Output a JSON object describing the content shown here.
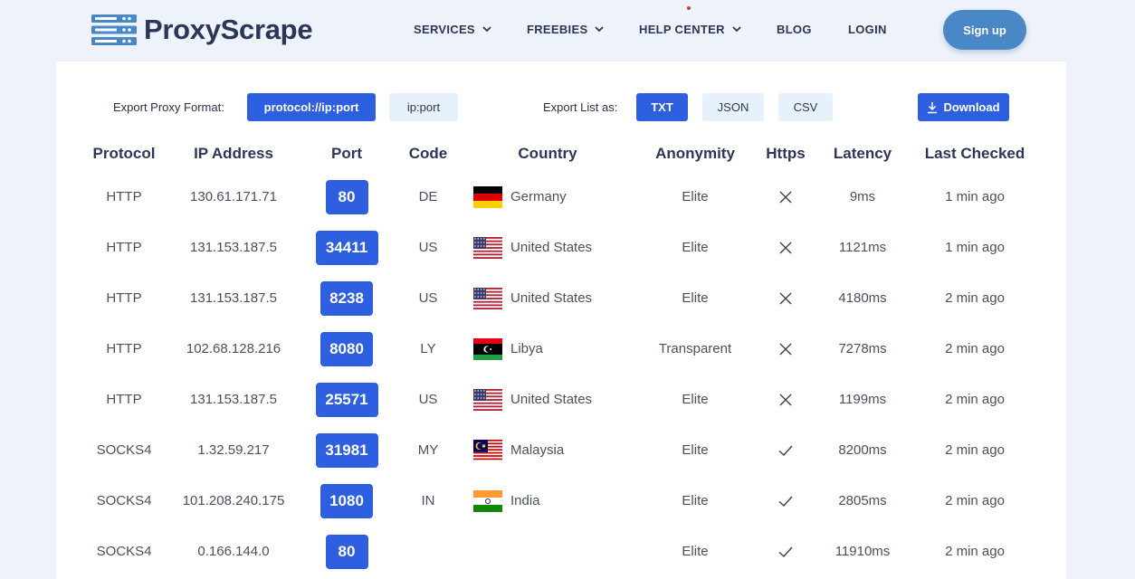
{
  "header": {
    "logo_text": "ProxyScrape",
    "nav": [
      {
        "label": "SERVICES",
        "dropdown": true
      },
      {
        "label": "FREEBIES",
        "dropdown": true
      },
      {
        "label": "HELP CENTER",
        "dropdown": true
      },
      {
        "label": "BLOG",
        "dropdown": false
      },
      {
        "label": "LOGIN",
        "dropdown": false
      }
    ],
    "signup_label": "Sign up"
  },
  "export": {
    "format_label": "Export Proxy Format:",
    "format_options": [
      "protocol://ip:port",
      "ip:port"
    ],
    "format_selected": "protocol://ip:port",
    "list_label": "Export List as:",
    "list_options": [
      "TXT",
      "JSON",
      "CSV"
    ],
    "list_selected": "TXT",
    "download_label": "Download"
  },
  "table": {
    "columns": [
      "Protocol",
      "IP Address",
      "Port",
      "Code",
      "Country",
      "Anonymity",
      "Https",
      "Latency",
      "Last Checked"
    ],
    "rows": [
      {
        "protocol": "HTTP",
        "ip": "130.61.171.71",
        "port": "80",
        "code": "DE",
        "country": "Germany",
        "flag": "de",
        "anonymity": "Elite",
        "https": false,
        "latency": "9ms",
        "checked": "1 min ago"
      },
      {
        "protocol": "HTTP",
        "ip": "131.153.187.5",
        "port": "34411",
        "code": "US",
        "country": "United States",
        "flag": "us",
        "anonymity": "Elite",
        "https": false,
        "latency": "1121ms",
        "checked": "1 min ago"
      },
      {
        "protocol": "HTTP",
        "ip": "131.153.187.5",
        "port": "8238",
        "code": "US",
        "country": "United States",
        "flag": "us",
        "anonymity": "Elite",
        "https": false,
        "latency": "4180ms",
        "checked": "2 min ago"
      },
      {
        "protocol": "HTTP",
        "ip": "102.68.128.216",
        "port": "8080",
        "code": "LY",
        "country": "Libya",
        "flag": "ly",
        "anonymity": "Transparent",
        "https": false,
        "latency": "7278ms",
        "checked": "2 min ago"
      },
      {
        "protocol": "HTTP",
        "ip": "131.153.187.5",
        "port": "25571",
        "code": "US",
        "country": "United States",
        "flag": "us",
        "anonymity": "Elite",
        "https": false,
        "latency": "1199ms",
        "checked": "2 min ago"
      },
      {
        "protocol": "SOCKS4",
        "ip": "1.32.59.217",
        "port": "31981",
        "code": "MY",
        "country": "Malaysia",
        "flag": "my",
        "anonymity": "Elite",
        "https": true,
        "latency": "8200ms",
        "checked": "2 min ago"
      },
      {
        "protocol": "SOCKS4",
        "ip": "101.208.240.175",
        "port": "1080",
        "code": "IN",
        "country": "India",
        "flag": "in",
        "anonymity": "Elite",
        "https": true,
        "latency": "2805ms",
        "checked": "2 min ago"
      },
      {
        "protocol": "SOCKS4",
        "ip": "0.166.144.0",
        "port": "80",
        "code": "",
        "country": "",
        "flag": "",
        "anonymity": "Elite",
        "https": true,
        "latency": "11910ms",
        "checked": "2 min ago"
      }
    ]
  },
  "colors": {
    "primary_blue": "#2e5fe0",
    "signup_blue": "#4a87c6",
    "header_bg": "#eef2fa",
    "inactive_button_bg": "#e7f1fb",
    "heading_text": "#2d3658"
  },
  "icons": {
    "logo": "server-stack-icon",
    "dropdown": "chevron-down-icon",
    "download": "download-arrow-icon",
    "https_no": "x-mark-icon",
    "https_yes": "check-mark-icon"
  }
}
